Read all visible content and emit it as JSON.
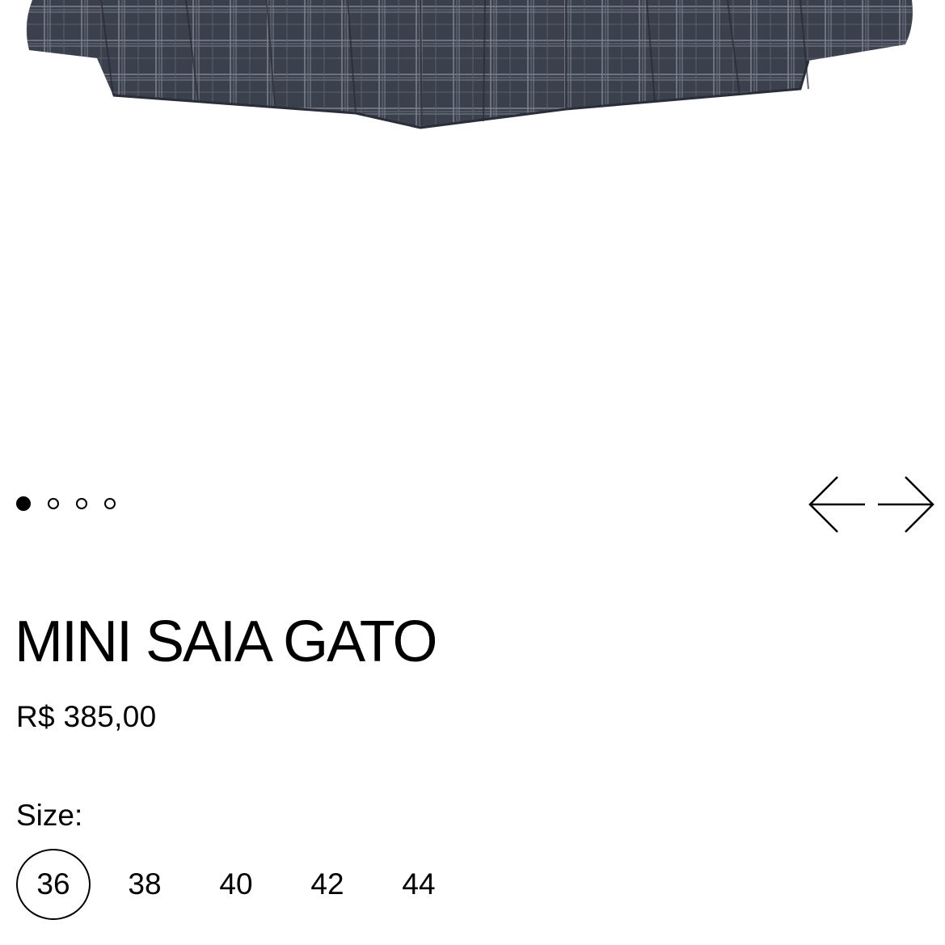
{
  "product": {
    "title": "MINI SAIA GATO",
    "price": "R$ 385,00"
  },
  "carousel": {
    "slide_count": 4,
    "active_index": 0,
    "prev_icon": "arrow-left-icon",
    "next_icon": "arrow-right-icon"
  },
  "size": {
    "label": "Size:",
    "options": [
      "36",
      "38",
      "40",
      "42",
      "44"
    ],
    "selected": "36"
  },
  "colors": {
    "skirt_base": "#3a3f4c",
    "skirt_line": "#8a8f9c",
    "text": "#000000"
  }
}
